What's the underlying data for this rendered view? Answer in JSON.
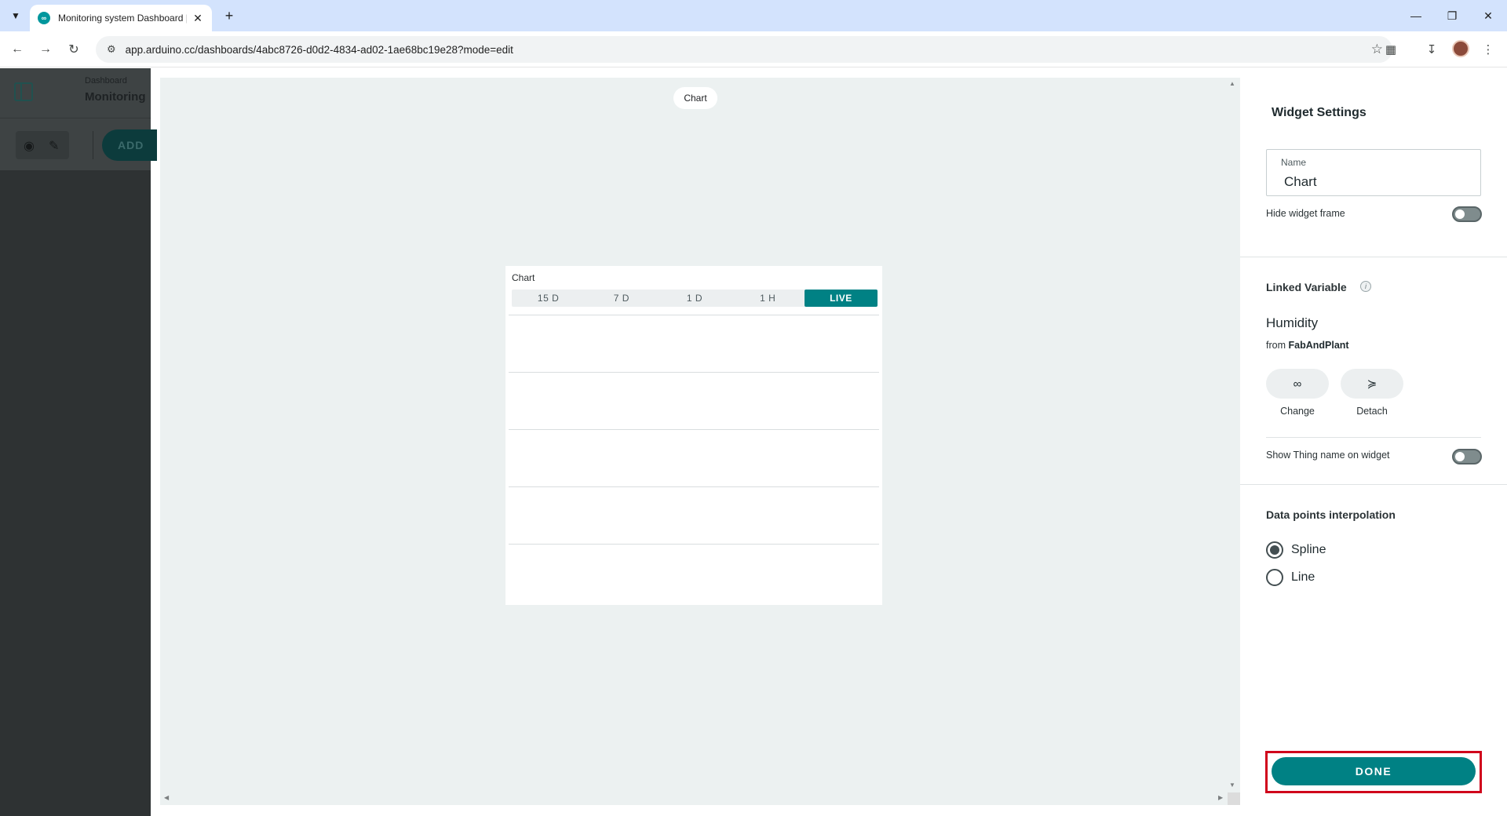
{
  "browser": {
    "tab_title": "Monitoring system Dashboard |",
    "url": "app.arduino.cc/dashboards/4abc8726-d0d2-4834-ad02-1ae68bc19e28?mode=edit"
  },
  "left_panel": {
    "breadcrumb_small": "Dashboard",
    "breadcrumb_title": "Monitoring",
    "add_label": "ADD"
  },
  "canvas": {
    "chip_label": "Chart",
    "widget": {
      "title": "Chart",
      "ranges": [
        "15 D",
        "7 D",
        "1 D",
        "1 H",
        "LIVE"
      ],
      "active_range": "LIVE"
    }
  },
  "settings": {
    "title": "Widget Settings",
    "name_label": "Name",
    "name_value": "Chart",
    "hide_frame_label": "Hide widget frame",
    "linked_variable_title": "Linked Variable",
    "variable_name": "Humidity",
    "from_prefix": "from",
    "thing_name": "FabAndPlant",
    "change_label": "Change",
    "detach_label": "Detach",
    "show_thing_label": "Show Thing name on widget",
    "interpolation_title": "Data points interpolation",
    "option_spline": "Spline",
    "option_line": "Line",
    "selected_option": "Spline",
    "done_label": "DONE"
  },
  "colors": {
    "accent": "#008184",
    "highlight": "#d0021b"
  }
}
